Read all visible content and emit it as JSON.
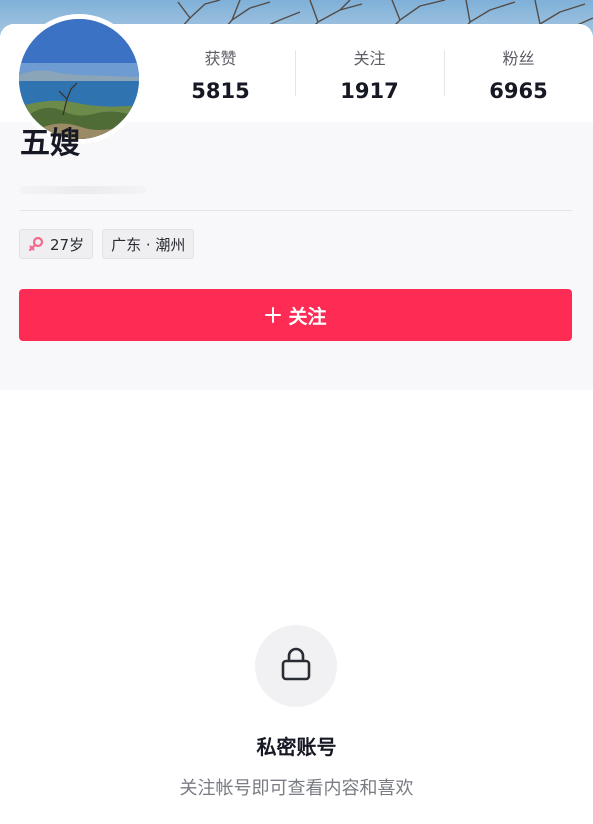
{
  "profile": {
    "name": "五嫂"
  },
  "stats": [
    {
      "label": "获赞",
      "value": "5815"
    },
    {
      "label": "关注",
      "value": "1917"
    },
    {
      "label": "粉丝",
      "value": "6965"
    }
  ],
  "tags": {
    "age": "27岁",
    "location": "广东 · 潮州"
  },
  "follow_button": {
    "label": "关注",
    "color": "#fe2c55"
  },
  "private": {
    "title": "私密账号",
    "subtitle": "关注帐号即可查看内容和喜欢"
  },
  "icons": {
    "gender": "female-icon",
    "follow": "plus-icon",
    "private": "lock-icon"
  }
}
